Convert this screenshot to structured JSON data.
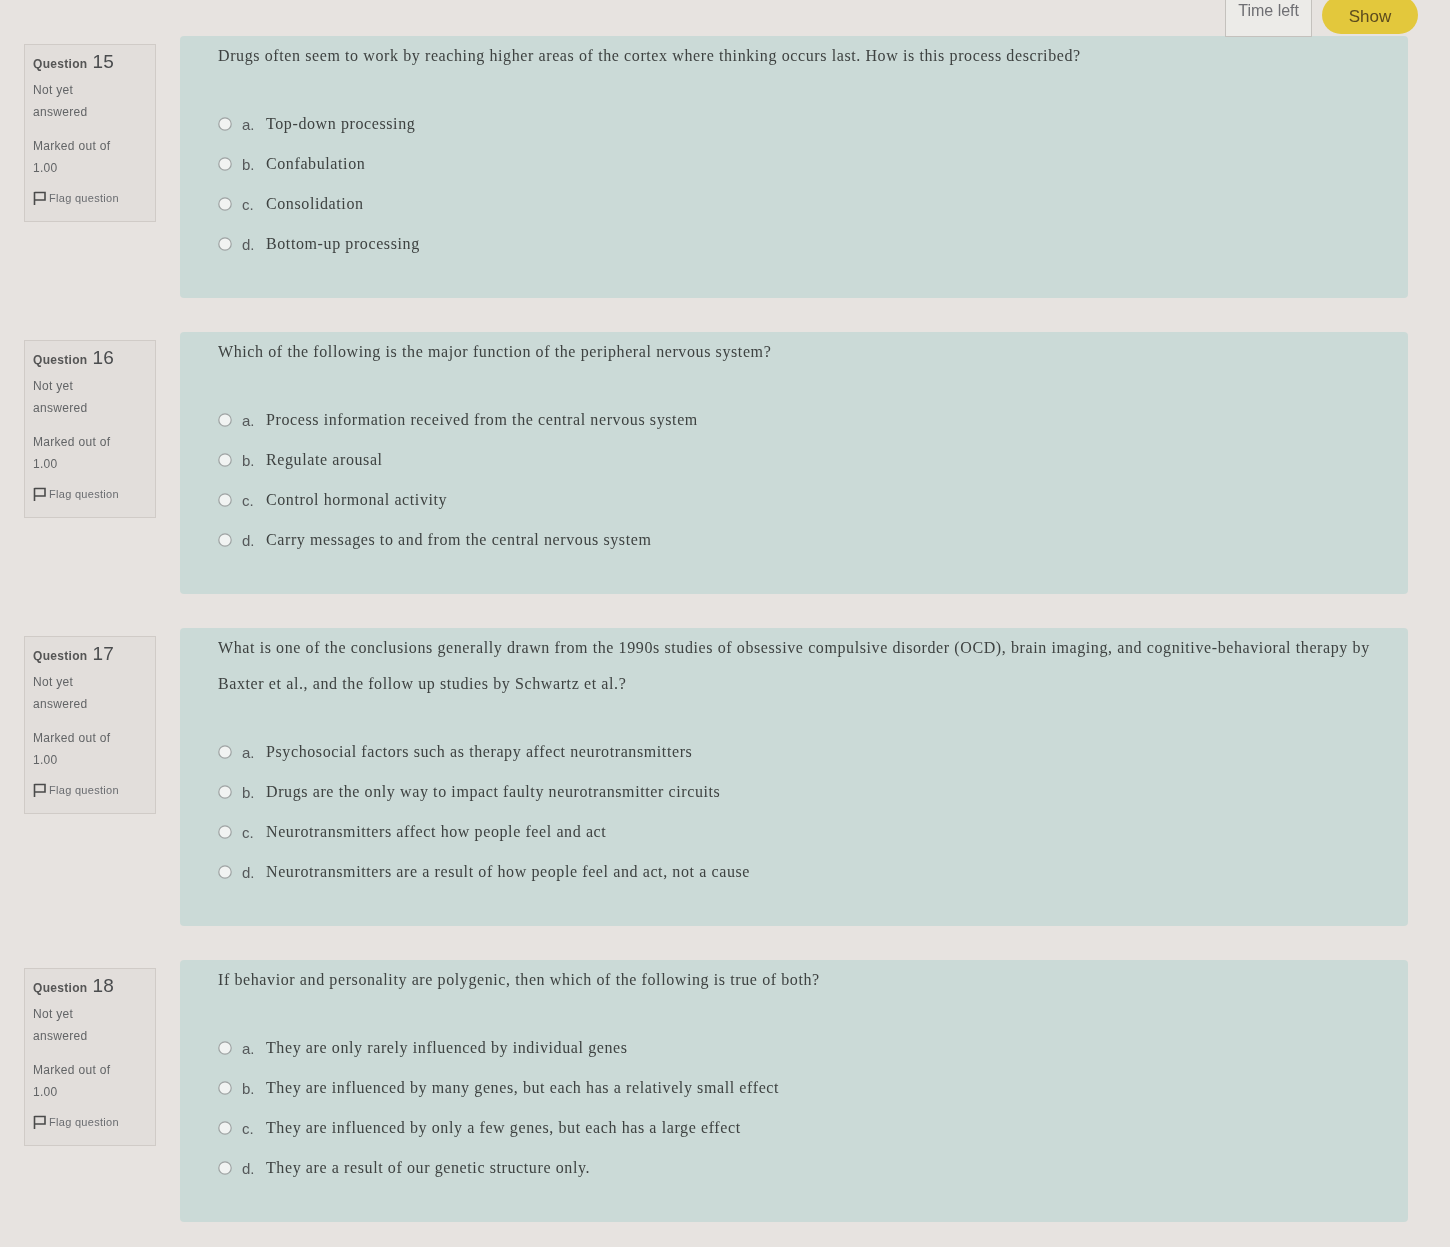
{
  "timer": {
    "label": "Time left",
    "button": "Show"
  },
  "questions": [
    {
      "heading": "Question",
      "number": "15",
      "status": "Not yet answered",
      "marks": "Marked out of 1.00",
      "flag": {
        "label": "Flag question",
        "flagged": false
      },
      "text": "Drugs often seem to work by reaching higher areas of the cortex where thinking occurs last. How is this process described?",
      "options": [
        {
          "letter": "a.",
          "text": "Top-down processing",
          "selected": false
        },
        {
          "letter": "b.",
          "text": "Confabulation",
          "selected": false
        },
        {
          "letter": "c.",
          "text": "Consolidation",
          "selected": false
        },
        {
          "letter": "d.",
          "text": "Bottom-up processing",
          "selected": false
        }
      ]
    },
    {
      "heading": "Question",
      "number": "16",
      "status": "Not yet answered",
      "marks": "Marked out of 1.00",
      "flag": {
        "label": "Flag question",
        "flagged": false
      },
      "text": "Which of the following is the major function of the peripheral nervous system?",
      "options": [
        {
          "letter": "a.",
          "text": "Process information received from the central nervous system",
          "selected": false
        },
        {
          "letter": "b.",
          "text": "Regulate arousal",
          "selected": false
        },
        {
          "letter": "c.",
          "text": "Control hormonal activity",
          "selected": false
        },
        {
          "letter": "d.",
          "text": "Carry messages to and from the central nervous system",
          "selected": false
        }
      ]
    },
    {
      "heading": "Question",
      "number": "17",
      "status": "Not yet answered",
      "marks": "Marked out of 1.00",
      "flag": {
        "label": "Flag question",
        "flagged": false
      },
      "text": "What is one of the conclusions generally drawn from the 1990s studies of obsessive compulsive disorder (OCD), brain imaging, and cognitive-behavioral therapy by Baxter et al., and the follow up studies by Schwartz et al.?",
      "options": [
        {
          "letter": "a.",
          "text": "Psychosocial factors such as therapy affect neurotransmitters",
          "selected": false
        },
        {
          "letter": "b.",
          "text": "Drugs are the only way to impact faulty neurotransmitter circuits",
          "selected": false
        },
        {
          "letter": "c.",
          "text": "Neurotransmitters affect how people feel and act",
          "selected": false
        },
        {
          "letter": "d.",
          "text": "Neurotransmitters are a result of how people feel and act, not a cause",
          "selected": false
        }
      ]
    },
    {
      "heading": "Question",
      "number": "18",
      "status": "Not yet answered",
      "marks": "Marked out of 1.00",
      "flag": {
        "label": "Flag question",
        "flagged": false
      },
      "text": "If behavior and personality are polygenic, then which of the following is true of both?",
      "options": [
        {
          "letter": "a.",
          "text": "They are only rarely influenced by individual genes",
          "selected": false
        },
        {
          "letter": "b.",
          "text": "They are influenced by many genes, but each has a relatively small effect",
          "selected": false
        },
        {
          "letter": "c.",
          "text": "They are influenced by only a few genes, but each has a large effect",
          "selected": false
        },
        {
          "letter": "d.",
          "text": "They are a result of our genetic structure only.",
          "selected": false
        }
      ]
    }
  ]
}
